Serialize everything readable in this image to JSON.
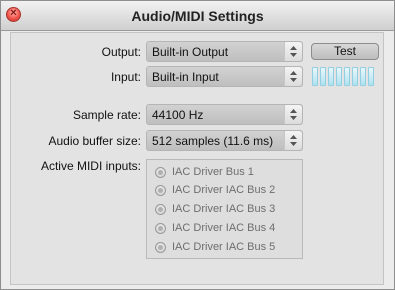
{
  "window": {
    "title": "Audio/MIDI Settings"
  },
  "output": {
    "label": "Output:",
    "value": "Built-in Output",
    "test_label": "Test"
  },
  "input": {
    "label": "Input:",
    "value": "Built-in Input",
    "level": 0
  },
  "sample_rate": {
    "label": "Sample rate:",
    "value": "44100 Hz"
  },
  "buffer": {
    "label": "Audio buffer size:",
    "value": "512 samples (11.6 ms)"
  },
  "midi": {
    "label": "Active MIDI inputs:",
    "items": [
      {
        "label": "IAC Driver Bus 1",
        "checked": false
      },
      {
        "label": "IAC Driver IAC Bus 2",
        "checked": false
      },
      {
        "label": "IAC Driver IAC Bus 3",
        "checked": false
      },
      {
        "label": "IAC Driver IAC Bus 4",
        "checked": false
      },
      {
        "label": "IAC Driver IAC Bus 5",
        "checked": false
      }
    ]
  },
  "colors": {
    "close_button": "#f0564c",
    "meter": "#aee1ef",
    "popup": "#c8c8c8"
  }
}
